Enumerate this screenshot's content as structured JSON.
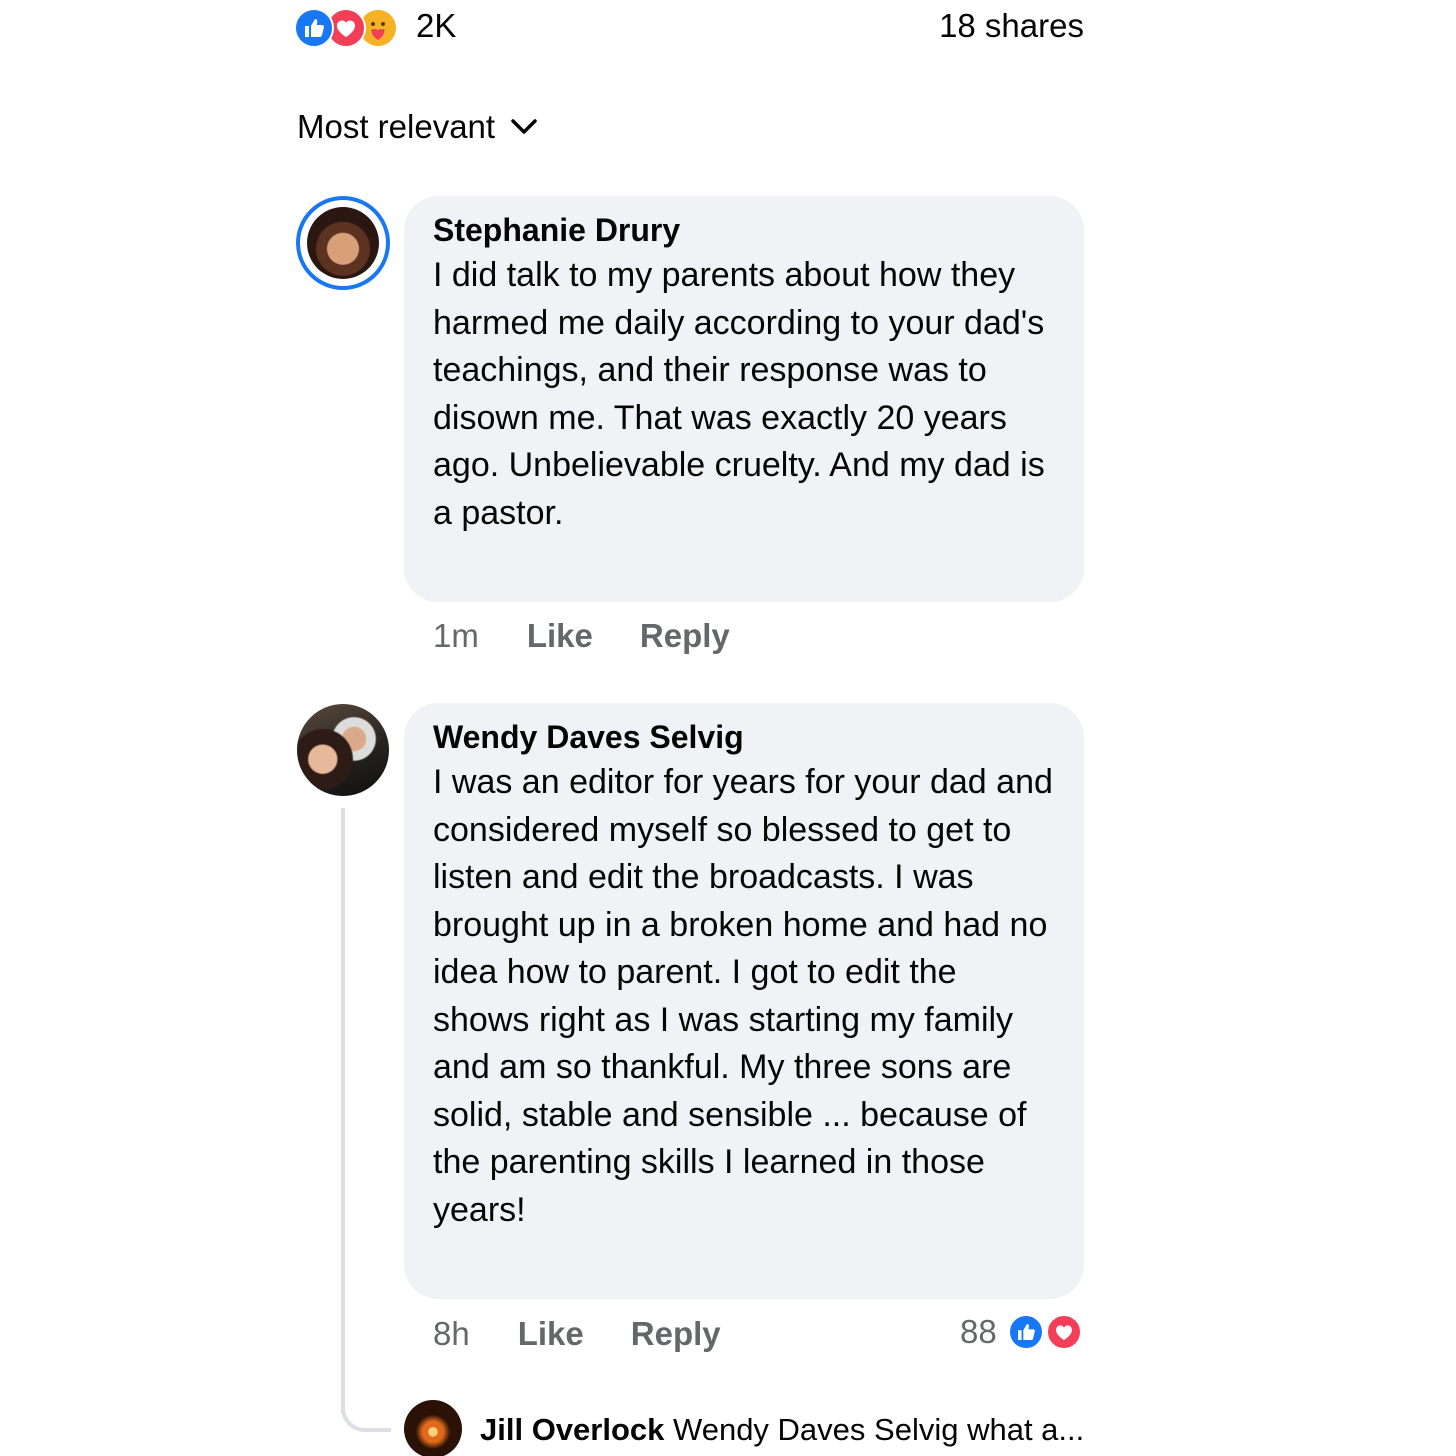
{
  "post_stats": {
    "reaction_icons": [
      "like-icon",
      "love-icon",
      "care-icon"
    ],
    "reaction_count": "2K",
    "shares": "18 shares"
  },
  "sort": {
    "label": "Most relevant",
    "icon": "chevron-down-icon"
  },
  "comments": [
    {
      "author": "Stephanie Drury",
      "text": "I did talk to my parents about how they harmed me daily according to your dad's teachings, and their response was to disown me. That was exactly 20 years ago. Unbelievable cruelty. And my dad is a pastor.",
      "time": "1m",
      "like_label": "Like",
      "reply_label": "Reply"
    },
    {
      "author": "Wendy Daves Selvig",
      "text": "I was an editor for years for your dad and considered myself so blessed to get to listen and edit the broadcasts. I was brought up in a broken home and had no idea how to parent. I got to edit the shows right as I was starting my family and am so thankful. My three sons are solid, stable and sensible ... because of the parenting skills I learned in those years!",
      "time": "8h",
      "like_label": "Like",
      "reply_label": "Reply",
      "reaction_count": "88",
      "reaction_icons": [
        "like-icon",
        "love-icon"
      ]
    }
  ],
  "reply_preview": {
    "author": "Jill Overlock",
    "text": "Wendy Daves Selvig what a..."
  },
  "colors": {
    "accent": "#1877f2",
    "love": "#f33e58",
    "care": "#f7b125",
    "bubble": "#f0f2f5",
    "secondary_text": "#65676b"
  }
}
